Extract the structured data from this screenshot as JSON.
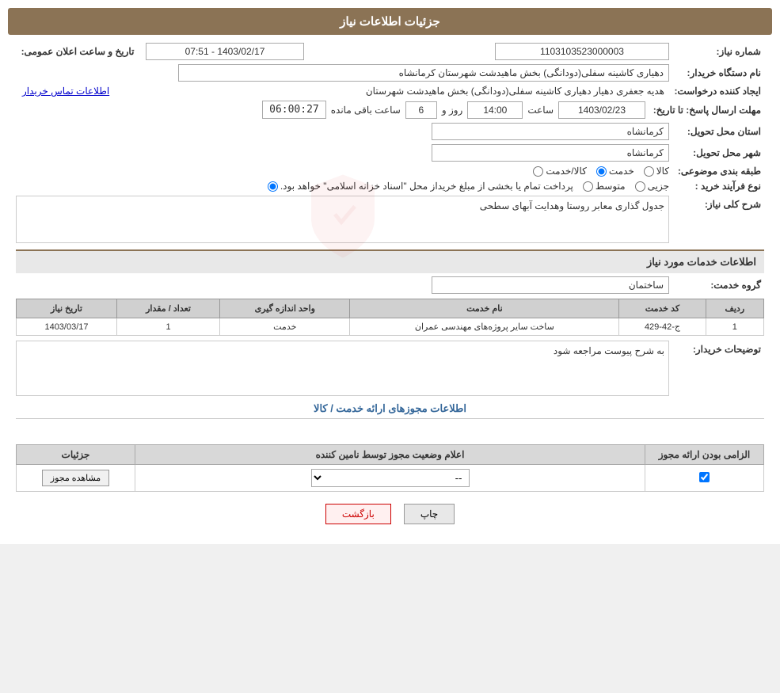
{
  "page": {
    "title": "جزئیات اطلاعات نیاز"
  },
  "header": {
    "title": "جزئیات اطلاعات نیاز"
  },
  "fields": {
    "shomareNiaz_label": "شماره نیاز:",
    "shomareNiaz_value": "1103103523000003",
    "namDastgah_label": "نام دستگاه خریدار:",
    "namDastgah_value": "دهیاری کاشینه سفلی(دودانگی) بخش ماهیدشت  شهرستان کرمانشاه",
    "ijadKonande_label": "ایجاد کننده درخواست:",
    "ijadKonande_value": "هدیه جعفری دهیار دهیاری کاشینه سفلی(دودانگی) بخش ماهیدشت  شهرستان",
    "ijadKonande_link": "اطلاعات تماس خریدار",
    "mohlat_label": "مهلت ارسال پاسخ: تا تاریخ:",
    "mohlat_date": "1403/02/23",
    "mohlat_saat_label": "ساعت",
    "mohlat_saat": "14:00",
    "mohlat_roz_label": "روز و",
    "mohlat_roz": "6",
    "mohlat_countdown_label": "ساعت باقی مانده",
    "mohlat_countdown": "06:00:27",
    "ostan_label": "استان محل تحویل:",
    "ostan_value": "کرمانشاه",
    "shahr_label": "شهر محل تحویل:",
    "shahr_value": "کرمانشاه",
    "tabaqe_label": "طبقه بندی موضوعی:",
    "tabaqe_options": [
      "کالا",
      "خدمت",
      "کالا/خدمت"
    ],
    "tabaqe_selected": "خدمت",
    "noeFarayand_label": "نوع فرآیند خرید :",
    "noeFarayand_options": [
      "جزیی",
      "متوسط",
      "پرداخت تمام یا بخشی از مبلغ خریداز محل \"اسناد خزانه اسلامی\" خواهد بود."
    ],
    "noeFarayand_selected": "پرداخت تمام یا بخشی از مبلغ خریداز محل \"اسناد خزانه اسلامی\" خواهد بود.",
    "sharhKoli_label": "شرح کلی نیاز:",
    "sharhKoli_value": "جدول گذاری معابر روستا وهدایت آبهای سطحی",
    "tarikhoSaat_label": "تاریخ و ساعت اعلان عمومی:",
    "tarikhoSaat_value": "1403/02/17 - 07:51"
  },
  "khadamat_section": {
    "title": "اطلاعات خدمات مورد نیاز",
    "grooh_label": "گروه خدمت:",
    "grooh_value": "ساختمان",
    "table": {
      "headers": [
        "ردیف",
        "کد خدمت",
        "نام خدمت",
        "واحد اندازه گیری",
        "تعداد / مقدار",
        "تاریخ نیاز"
      ],
      "rows": [
        {
          "radif": "1",
          "kod": "ج-42-429",
          "name": "ساخت سایر پروژه‌های مهندسی عمران",
          "vahed": "خدمت",
          "tedad": "1",
          "tarikh": "1403/03/17"
        }
      ]
    },
    "buyer_notes_label": "توضیحات خریدار:",
    "buyer_notes_value": "به شرح پیوست مراجعه شود"
  },
  "licenses_section": {
    "title": "اطلاعات مجوزهای ارائه خدمت / کالا",
    "table": {
      "headers": [
        "الزامی بودن ارائه مجوز",
        "اعلام وضعیت مجوز توسط نامین کننده",
        "جزئیات"
      ],
      "rows": [
        {
          "elzami": true,
          "aelamVaziat": "--",
          "joziyat": "مشاهده مجوز"
        }
      ]
    }
  },
  "buttons": {
    "print_label": "چاپ",
    "back_label": "بازگشت"
  }
}
